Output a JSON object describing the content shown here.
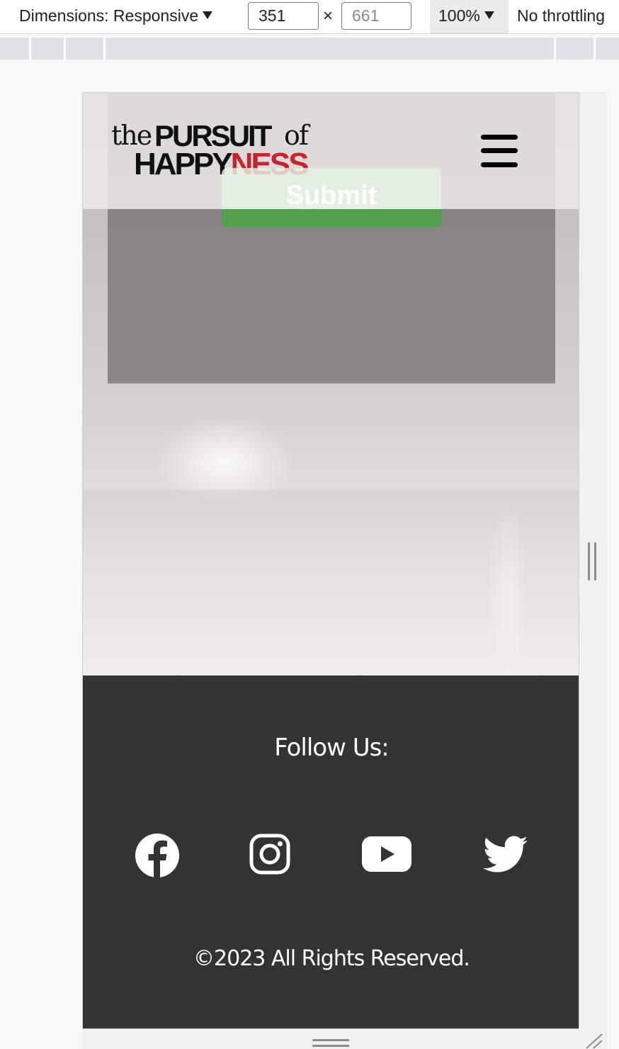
{
  "devtools": {
    "dimensions_label": "Dimensions: Responsive",
    "width_value": "351",
    "height_placeholder": "661",
    "times_symbol": "×",
    "zoom_label": "100%",
    "throttling_label": "No throttling"
  },
  "site": {
    "logo": {
      "the": "the",
      "pursuit": "PURSUIT",
      "of": "of",
      "happy": "HAPPY",
      "ness": "NESS"
    },
    "submit_label": "Submit",
    "footer": {
      "follow_label": "Follow Us:",
      "social_icons": [
        "facebook-icon",
        "instagram-icon",
        "youtube-icon",
        "twitter-icon"
      ],
      "copyright": "©2023 All Rights Reserved."
    }
  },
  "colors": {
    "footer_bg": "#333333",
    "submit_green": "#52a04e",
    "logo_red": "#c3262c"
  }
}
